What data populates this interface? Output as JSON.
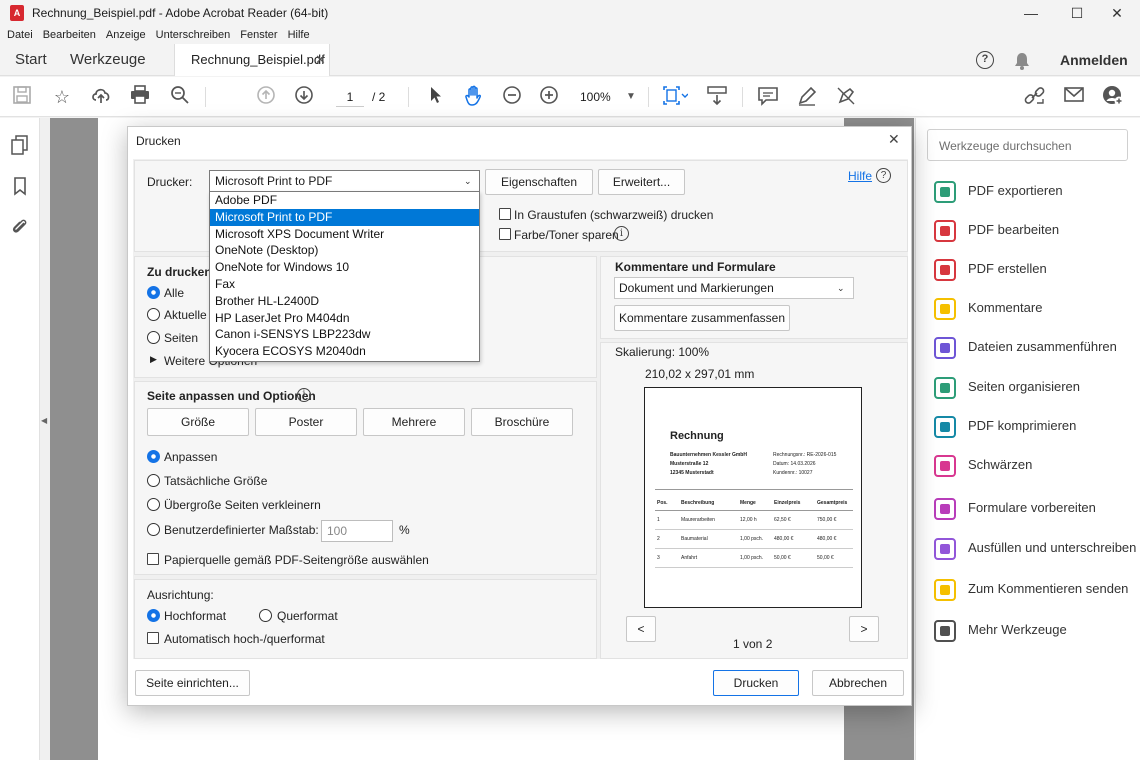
{
  "window": {
    "title": "Rechnung_Beispiel.pdf - Adobe Acrobat Reader (64-bit)",
    "logo_text": "A",
    "minimize": "—",
    "maximize": "☐",
    "close": "✕"
  },
  "menu": [
    "Datei",
    "Bearbeiten",
    "Anzeige",
    "Unterschreiben",
    "Fenster",
    "Hilfe"
  ],
  "tabs": {
    "start": "Start",
    "tools": "Werkzeuge",
    "document": "Rechnung_Beispiel.pdf",
    "close": "✕",
    "help": "?",
    "signin": "Anmelden"
  },
  "toolbar": {
    "page_current": "1",
    "page_total": "/ 2",
    "zoom": "100%"
  },
  "right_panel": {
    "search_placeholder": "Werkzeuge durchsuchen",
    "tools": [
      {
        "label": "PDF exportieren",
        "icon": "pdf-export-icon",
        "color": "#2d9d78"
      },
      {
        "label": "PDF bearbeiten",
        "icon": "pdf-edit-icon",
        "color": "#d7373f"
      },
      {
        "label": "PDF erstellen",
        "icon": "pdf-create-icon",
        "color": "#d7373f"
      },
      {
        "label": "Kommentare",
        "icon": "comment-icon",
        "color": "#f5c000"
      },
      {
        "label": "Dateien zusammenführen",
        "icon": "combine-files-icon",
        "color": "#6e55d6"
      },
      {
        "label": "Seiten organisieren",
        "icon": "organize-pages-icon",
        "color": "#2d9d78"
      },
      {
        "label": "PDF komprimieren",
        "icon": "compress-pdf-icon",
        "color": "#1589a6"
      },
      {
        "label": "Schwärzen",
        "icon": "redact-icon",
        "color": "#d83790"
      },
      {
        "label": "Formulare vorbereiten",
        "icon": "prepare-form-icon",
        "color": "#b83dba"
      },
      {
        "label": "Ausfüllen und unterschreiben",
        "icon": "fill-sign-icon",
        "color": "#9256d9"
      },
      {
        "label": "Zum Kommentieren senden",
        "icon": "send-comment-icon",
        "color": "#f5c000"
      },
      {
        "label": "Mehr Werkzeuge",
        "icon": "more-tools-icon",
        "color": "#505050"
      }
    ]
  },
  "dialog": {
    "title": "Drucken",
    "close": "✕",
    "printer_label": "Drucker:",
    "printer_value": "Microsoft Print to PDF",
    "properties_button": "Eigenschaften",
    "advanced_button": "Erweitert...",
    "help_link": "Hilfe",
    "help_icon": "?",
    "grayscale_label": "In Graustufen (schwarzweiß) drucken",
    "grayscale_checked": false,
    "save_toner_label": "Farbe/Toner sparen",
    "save_toner_checked": false,
    "info_icon": "i",
    "printer_options": [
      "Adobe PDF",
      "Microsoft Print to PDF",
      "Microsoft XPS Document Writer",
      "OneNote (Desktop)",
      "OneNote for Windows 10",
      "Fax",
      "Brother HL-L2400D",
      "HP LaserJet Pro M404dn",
      "Canon i-SENSYS LBP223dw",
      "Kyocera ECOSYS M2040dn"
    ],
    "selected_printer_index": 1,
    "pages_heading": "Zu druckend",
    "pages_options": [
      "Alle",
      "Aktuelle S",
      "Seiten"
    ],
    "pages_selected": 0,
    "more_options": "Weitere Optionen",
    "fit_heading": "Seite anpassen und Optionen",
    "size_buttons": [
      "Größe",
      "Poster",
      "Mehrere",
      "Broschüre"
    ],
    "fit_options": [
      "Anpassen",
      "Tatsächliche Größe",
      "Übergroße Seiten verkleinern",
      "Benutzerdefinierter Maßstab:"
    ],
    "fit_selected": 0,
    "custom_scale_value": "100",
    "percent": "%",
    "paper_source_label": "Papierquelle gemäß PDF-Seitengröße auswählen",
    "orientation_heading": "Ausrichtung:",
    "orientation_options": [
      "Hochformat",
      "Querformat"
    ],
    "orientation_selected": 0,
    "auto_rotate_label": "Automatisch hoch-/querformat",
    "comments_heading": "Kommentare und Formulare",
    "comments_value": "Dokument und Markierungen",
    "summarize_button": "Kommentare zusammenfassen",
    "scaling_label": "Skalierung: 100%",
    "page_size_label": "210,02 x 297,01 mm",
    "prev_button": "<",
    "next_button": ">",
    "preview_page_label": "1 von 2",
    "setup_button": "Seite einrichten...",
    "print_button": "Drucken",
    "cancel_button": "Abbrechen"
  },
  "preview": {
    "title": "Rechnung",
    "sender": [
      "Bauunternehmen Kessler GmbH",
      "Musterstraße 12",
      "12345 Musterstadt"
    ],
    "meta": [
      "Rechnungsnr.: RE-2026-015",
      "Datum: 14.03.2026",
      "Kundennr.: 10027"
    ],
    "headers": [
      "Pos.",
      "Beschreibung",
      "Menge",
      "Einzelpreis",
      "Gesamtpreis"
    ],
    "rows": [
      [
        "1",
        "Maurerarbeiten",
        "12,00 h",
        "62,50 €",
        "750,00 €"
      ],
      [
        "2",
        "Baumaterial",
        "1,00 psch.",
        "480,00 €",
        "480,00 €"
      ],
      [
        "3",
        "Anfahrt",
        "1,00 psch.",
        "50,00 €",
        "50,00 €"
      ]
    ]
  }
}
